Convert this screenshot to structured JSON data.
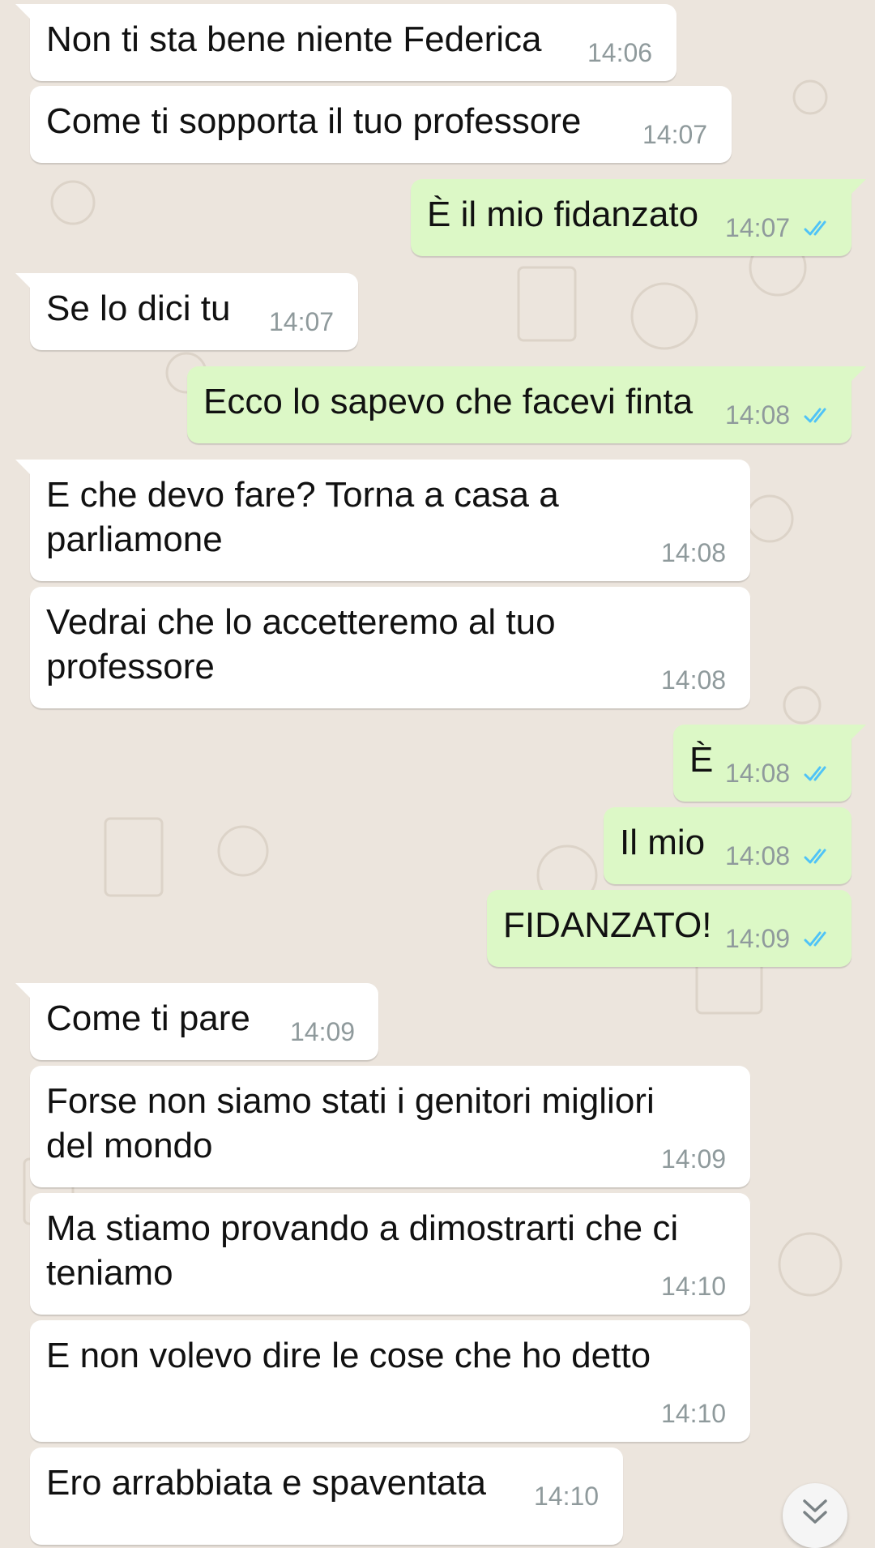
{
  "chat": {
    "messages": [
      {
        "direction": "in",
        "text": "Non ti sta bene niente Federica",
        "time": "14:06"
      },
      {
        "direction": "in",
        "text": "Come ti sopporta il tuo professore",
        "time": "14:07"
      },
      {
        "direction": "out",
        "text": "È il mio fidanzato",
        "time": "14:07",
        "status": "read"
      },
      {
        "direction": "in",
        "text": "Se lo dici tu",
        "time": "14:07"
      },
      {
        "direction": "out",
        "text": "Ecco lo sapevo che facevi finta",
        "time": "14:08",
        "status": "read"
      },
      {
        "direction": "in",
        "text": "E che devo fare? Torna a casa a\nparliamone",
        "time": "14:08"
      },
      {
        "direction": "in",
        "text": "Vedrai che lo accetteremo al tuo\nprofessore",
        "time": "14:08"
      },
      {
        "direction": "out",
        "text": "È",
        "time": "14:08",
        "status": "read"
      },
      {
        "direction": "out",
        "text": "Il mio",
        "time": "14:08",
        "status": "read"
      },
      {
        "direction": "out",
        "text": "FIDANZATO!",
        "time": "14:09",
        "status": "read"
      },
      {
        "direction": "in",
        "text": "Come ti pare",
        "time": "14:09"
      },
      {
        "direction": "in",
        "text": "Forse non siamo stati i genitori migliori\ndel mondo",
        "time": "14:09"
      },
      {
        "direction": "in",
        "text": "Ma stiamo provando a dimostrarti che ci\nteniamo",
        "time": "14:10"
      },
      {
        "direction": "in",
        "text": "E non volevo dire le cose che ho detto",
        "time": "14:10"
      },
      {
        "direction": "in",
        "text": "Ero arrabbiata e spaventata",
        "time": "14:10"
      }
    ]
  },
  "icons": {
    "read_ticks": "double-check-icon",
    "scroll_down": "double-chevron-down-icon"
  },
  "colors": {
    "chat_background": "#ece5dd",
    "incoming_bubble": "#ffffff",
    "outgoing_bubble": "#dcf8c6",
    "timestamp": "#8f9a9c",
    "read_ticks": "#4fc3f7"
  }
}
